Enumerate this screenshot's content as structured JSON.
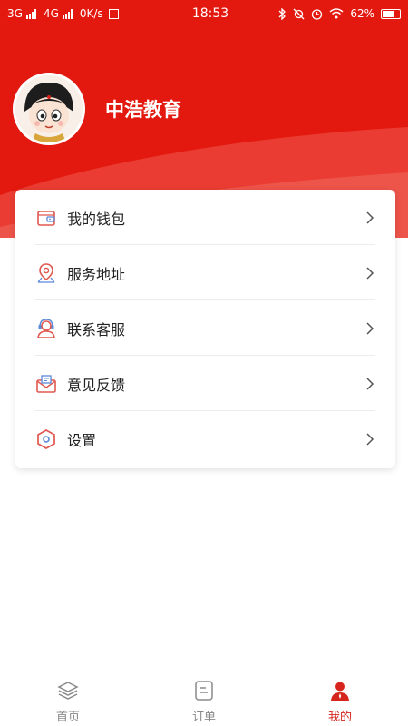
{
  "status_bar": {
    "network1": "3G",
    "network2": "4G",
    "speed": "0K/s",
    "time": "18:53",
    "battery": "62%"
  },
  "profile": {
    "name": "中浩教育"
  },
  "menu": [
    {
      "label": "我的钱包",
      "icon": "wallet-icon"
    },
    {
      "label": "服务地址",
      "icon": "location-pin-icon"
    },
    {
      "label": "联系客服",
      "icon": "customer-service-icon"
    },
    {
      "label": "意见反馈",
      "icon": "feedback-envelope-icon"
    },
    {
      "label": "设置",
      "icon": "settings-hexagon-icon"
    }
  ],
  "tabbar": {
    "tabs": [
      {
        "label": "首页",
        "icon": "layers-icon",
        "active": false
      },
      {
        "label": "订单",
        "icon": "order-list-icon",
        "active": false
      },
      {
        "label": "我的",
        "icon": "user-icon",
        "active": true
      }
    ]
  },
  "colors": {
    "brand_red": "#e3190f",
    "active_tab": "#d5251c",
    "inactive_tab": "#888888"
  }
}
